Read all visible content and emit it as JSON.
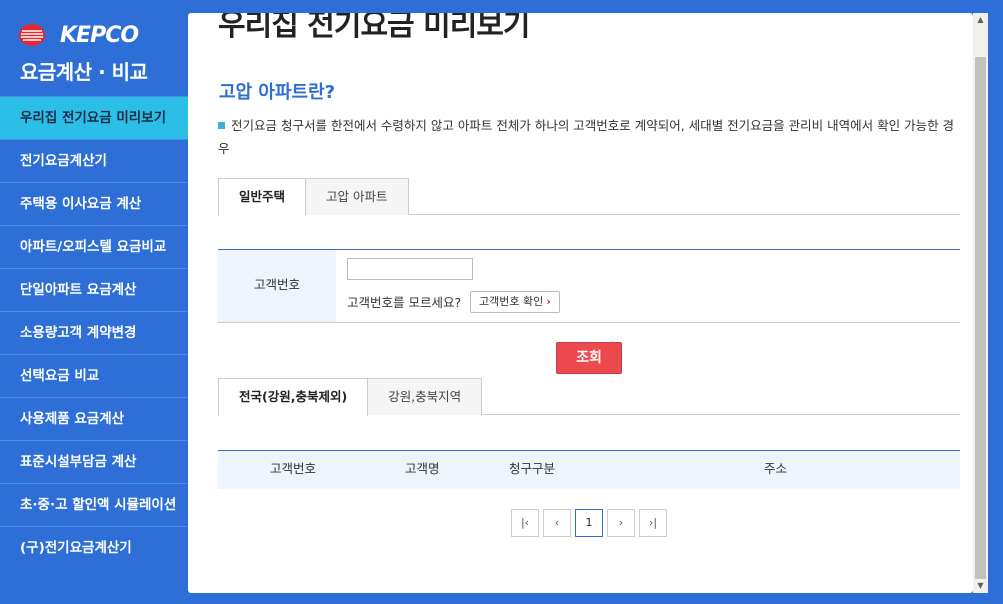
{
  "brand": {
    "logo_text": "KEPCO",
    "subtitle": "요금계산 · 비교"
  },
  "sidebar": {
    "items": [
      {
        "label": "우리집 전기요금 미리보기",
        "active": true
      },
      {
        "label": "전기요금계산기"
      },
      {
        "label": "주택용 이사요금 계산"
      },
      {
        "label": "아파트/오피스텔 요금비교"
      },
      {
        "label": "단일아파트 요금계산"
      },
      {
        "label": "소용량고객 계약변경"
      },
      {
        "label": "선택요금 비교"
      },
      {
        "label": "사용제품 요금계산"
      },
      {
        "label": "표준시설부담금 계산"
      },
      {
        "label": "초·중·고 할인액 시뮬레이션"
      },
      {
        "label": "(구)전기요금계산기"
      }
    ]
  },
  "main": {
    "page_title": "우리집 전기요금 미리보기",
    "section_title": "고압 아파트란?",
    "description": "전기요금 청구서를 한전에서 수령하지 않고 아파트 전체가 하나의 고객번호로 계약되어, 세대별 전기요금을 관리비 내역에서 확인 가능한 경우",
    "tabs": [
      {
        "label": "일반주택",
        "active": true
      },
      {
        "label": "고압 아파트"
      }
    ],
    "form": {
      "customer_label": "고객번호",
      "customer_value": "",
      "help_text": "고객번호를 모르세요?",
      "help_button": "고객번호 확인"
    },
    "search_button": "조회",
    "region_tabs": [
      {
        "label": "전국(강원,충북제외)",
        "active": true
      },
      {
        "label": "강원,충북지역"
      }
    ],
    "result_columns": [
      "고객번호",
      "고객명",
      "청구구분",
      "주소"
    ],
    "pagination": {
      "current": "1"
    }
  }
}
